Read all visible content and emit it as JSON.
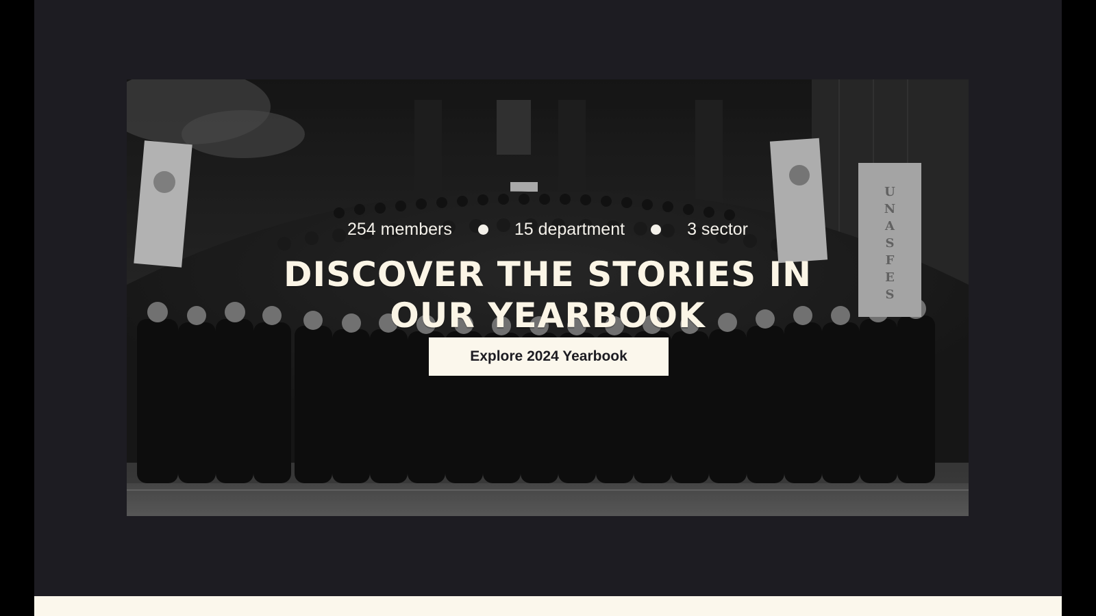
{
  "hero": {
    "stats": [
      {
        "label": "254 members"
      },
      {
        "label": "15 department"
      },
      {
        "label": "3 sector"
      }
    ],
    "headline_line1": "DISCOVER THE STORIES IN",
    "headline_line2": "OUR YEARBOOK",
    "cta_label": "Explore 2024 Yearbook"
  },
  "banners": {
    "right_banner_text": "UNASFES"
  },
  "colors": {
    "page_background": "#1d1c22",
    "outer_background": "#000000",
    "cream": "#fbf7ec",
    "text_light": "#f4f1ea"
  }
}
